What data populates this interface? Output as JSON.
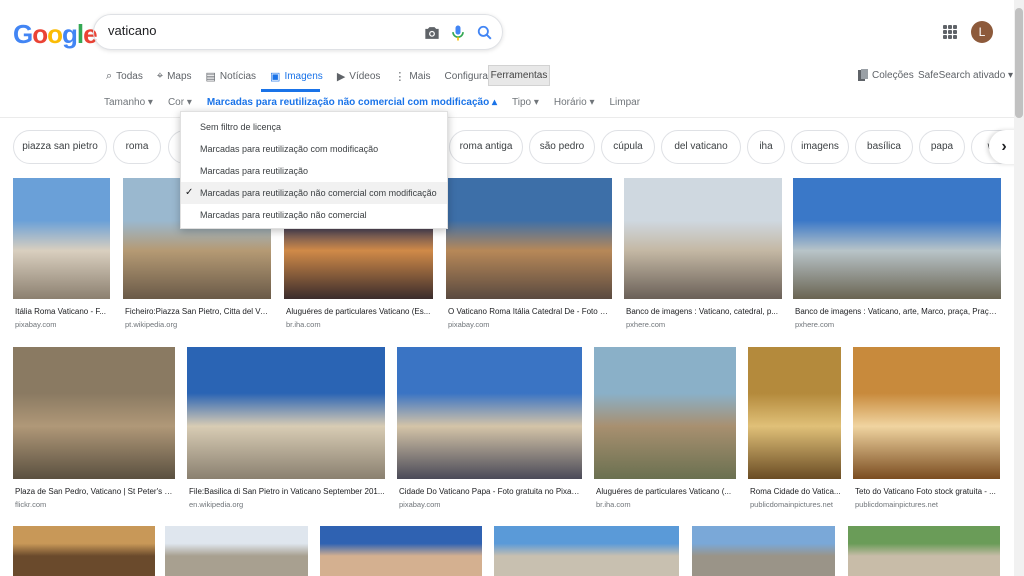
{
  "search": {
    "query": "vaticano"
  },
  "logo": [
    "G",
    "o",
    "o",
    "g",
    "l",
    "e"
  ],
  "user": {
    "avatar_letter": "L"
  },
  "tabs": [
    {
      "label": "Todas",
      "icon": "search-icon"
    },
    {
      "label": "Maps",
      "icon": "map-pin-icon"
    },
    {
      "label": "Notícias",
      "icon": "news-icon"
    },
    {
      "label": "Imagens",
      "icon": "image-icon"
    },
    {
      "label": "Vídeos",
      "icon": "video-icon"
    },
    {
      "label": "Mais",
      "icon": "more-vert-icon"
    },
    {
      "label": "Configurações"
    }
  ],
  "ferramentas": "Ferramentas",
  "colecoes": "Coleções",
  "safesearch": "SafeSearch ativado ▾",
  "tools": [
    "Tamanho ▾",
    "Cor ▾",
    "Marcadas para reutilização não comercial com modificação ▴",
    "Tipo ▾",
    "Horário ▾",
    "Limpar"
  ],
  "chips": [
    "piazza san pietro",
    "roma",
    "r",
    "roma antiga",
    "são pedro",
    "cúpula",
    "del vaticano",
    "iha",
    "imagens",
    "basílica",
    "papa",
    "wiki"
  ],
  "menu": {
    "items": [
      "Sem filtro de licença",
      "Marcadas para reutilização com modificação",
      "Marcadas para reutilização",
      "Marcadas para reutilização não comercial com modificação",
      "Marcadas para reutilização não comercial"
    ],
    "selected_index": 3,
    "check": "✓"
  },
  "row1": [
    {
      "caption": "Itália Roma Vaticano - F...",
      "source": "pixabay.com",
      "colors": [
        "#6aa0d8",
        "#d9cfbf",
        "#8c8070"
      ]
    },
    {
      "caption": "Ficheiro:Piazza San Pietro, Citta del Va...",
      "source": "pt.wikipedia.org",
      "colors": [
        "#9ab8cf",
        "#b59a74",
        "#6a5a48"
      ]
    },
    {
      "caption": "Aluguéres de particulares Vaticano (Es...",
      "source": "br.iha.com",
      "colors": [
        "#1e2c5c",
        "#d08a48",
        "#3a2c2c"
      ]
    },
    {
      "caption": "O Vaticano Roma Itália Catedral De - Foto gr...",
      "source": "pixabay.com",
      "colors": [
        "#3d6fa8",
        "#b78858",
        "#5a4a40"
      ]
    },
    {
      "caption": "Banco de imagens : Vaticano, catedral, p...",
      "source": "pxhere.com",
      "colors": [
        "#cfd8e0",
        "#c4b8a4",
        "#6a6058"
      ]
    },
    {
      "caption": "Banco de imagens : Vaticano, arte, Marco, praça, Praça ...",
      "source": "pxhere.com",
      "colors": [
        "#3a78c8",
        "#b8c4c8",
        "#6a6452"
      ]
    }
  ],
  "row2": [
    {
      "caption": "Plaza de San Pedro, Vaticano | St Peter's S...",
      "source": "flickr.com",
      "colors": [
        "#8a7a62",
        "#b09878",
        "#5a5040"
      ]
    },
    {
      "caption": "File:Basilica di San Pietro in Vaticano September 201...",
      "source": "en.wikipedia.org",
      "colors": [
        "#2a64b4",
        "#d8ccb4",
        "#8a8070"
      ]
    },
    {
      "caption": "Cidade Do Vaticano Papa - Foto gratuita no Pixab...",
      "source": "pixabay.com",
      "colors": [
        "#3a74c4",
        "#d4c4a8",
        "#4a4a58"
      ]
    },
    {
      "caption": "Aluguéres de particulares Vaticano (...",
      "source": "br.iha.com",
      "colors": [
        "#8ab0c8",
        "#a89070",
        "#6a7050"
      ]
    },
    {
      "caption": "Roma Cidade do Vatica...",
      "source": "publicdomainpictures.net",
      "colors": [
        "#b48a3c",
        "#e0c078",
        "#6a4c24"
      ]
    },
    {
      "caption": "Teto do Vaticano Foto stock gratuita - ...",
      "source": "publicdomainpictures.net",
      "colors": [
        "#c88a3c",
        "#f0d4a0",
        "#7a4c20"
      ]
    }
  ],
  "row3": [
    {
      "colors": [
        "#c89858",
        "#6a4a2c"
      ]
    },
    {
      "colors": [
        "#dfe6ee",
        "#a8a090"
      ]
    },
    {
      "colors": [
        "#2f62b2",
        "#d4b090"
      ]
    },
    {
      "colors": [
        "#5a9ad8",
        "#c8c0b0"
      ]
    },
    {
      "colors": [
        "#7aa8d8",
        "#9a9488"
      ]
    },
    {
      "colors": [
        "#6a9c58",
        "#c8bca8"
      ]
    }
  ]
}
